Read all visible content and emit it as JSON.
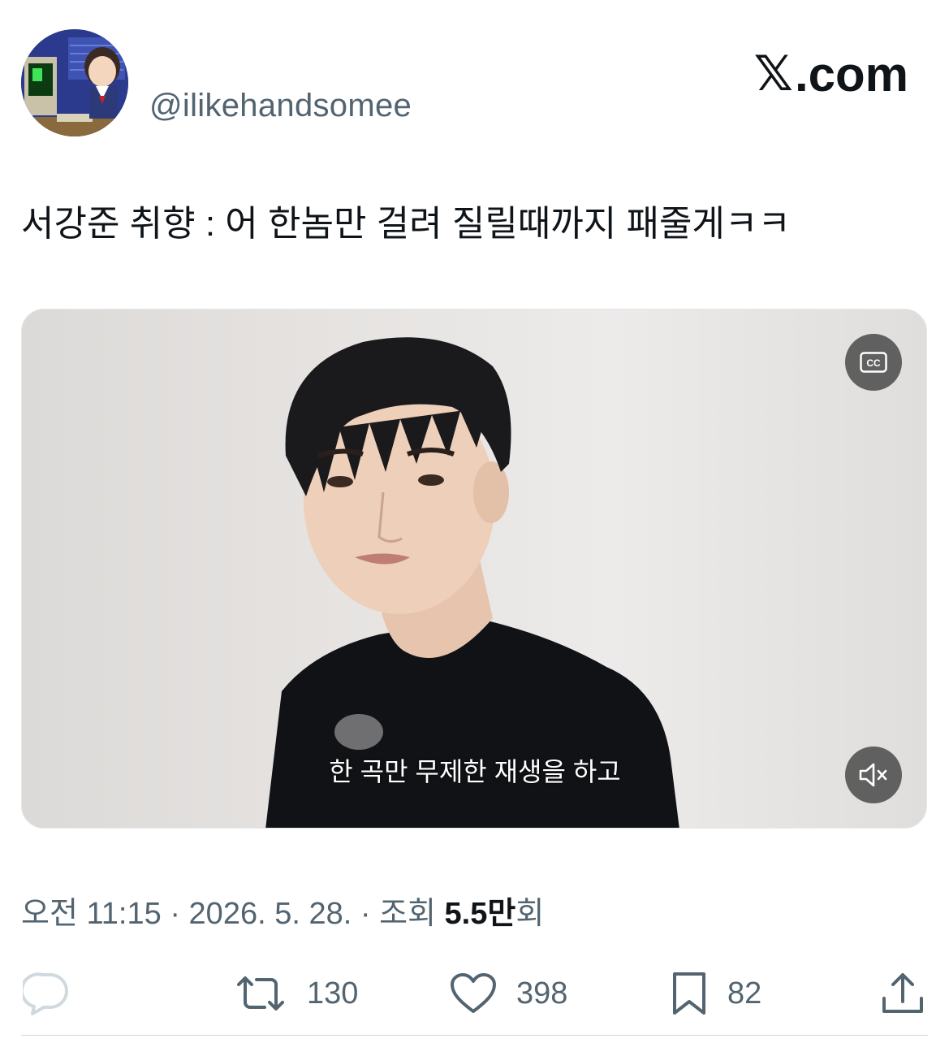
{
  "author": {
    "handle": "@ilikehandsomee"
  },
  "brand": {
    "x_glyph": "𝕏",
    "domain": ".com"
  },
  "tweet": {
    "text": "서강준 취향 : 어 한놈만 걸려 질릴때까지 패줄게ㅋㅋ"
  },
  "media": {
    "subtitle": "한 곡만 무제한 재생을 하고",
    "cc_icon": "closed-captions-icon",
    "mute_icon": "volume-muted-icon"
  },
  "meta": {
    "time": "오전 11:15",
    "separator": "·",
    "date": "2026. 5. 28.",
    "views_label": "조회",
    "views_number": "5.5만",
    "views_suffix": "회"
  },
  "actions": {
    "reply_icon": "reply-icon",
    "retweet_icon": "retweet-icon",
    "retweet_count": "130",
    "like_icon": "heart-icon",
    "like_count": "398",
    "bookmark_icon": "bookmark-icon",
    "bookmark_count": "82",
    "share_icon": "share-icon"
  },
  "colors": {
    "text_primary": "#0f1419",
    "text_secondary": "#536471",
    "reply_icon": "#cfd9de",
    "divider": "#cfd9de"
  }
}
